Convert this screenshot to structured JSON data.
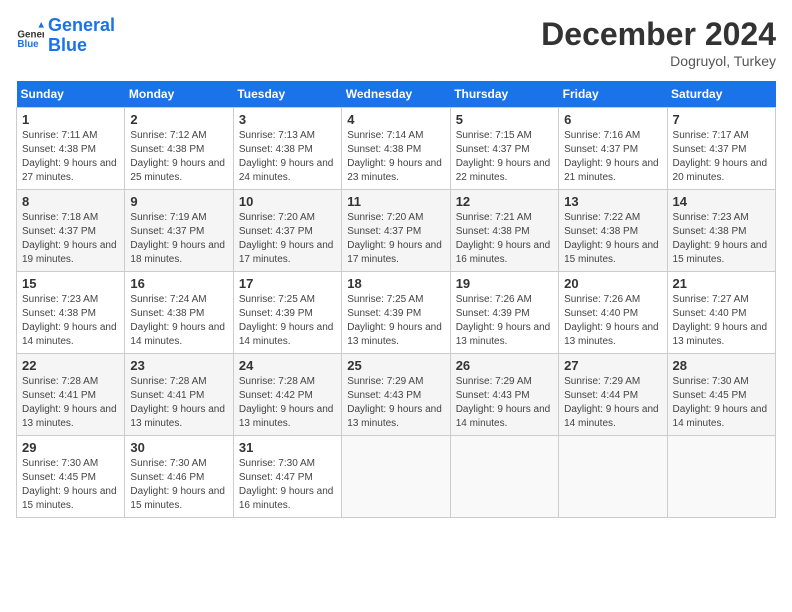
{
  "header": {
    "logo_line1": "General",
    "logo_line2": "Blue",
    "month": "December 2024",
    "location": "Dogruyol, Turkey"
  },
  "weekdays": [
    "Sunday",
    "Monday",
    "Tuesday",
    "Wednesday",
    "Thursday",
    "Friday",
    "Saturday"
  ],
  "weeks": [
    [
      {
        "day": "1",
        "sunrise": "7:11 AM",
        "sunset": "4:38 PM",
        "daylight": "9 hours and 27 minutes."
      },
      {
        "day": "2",
        "sunrise": "7:12 AM",
        "sunset": "4:38 PM",
        "daylight": "9 hours and 25 minutes."
      },
      {
        "day": "3",
        "sunrise": "7:13 AM",
        "sunset": "4:38 PM",
        "daylight": "9 hours and 24 minutes."
      },
      {
        "day": "4",
        "sunrise": "7:14 AM",
        "sunset": "4:38 PM",
        "daylight": "9 hours and 23 minutes."
      },
      {
        "day": "5",
        "sunrise": "7:15 AM",
        "sunset": "4:37 PM",
        "daylight": "9 hours and 22 minutes."
      },
      {
        "day": "6",
        "sunrise": "7:16 AM",
        "sunset": "4:37 PM",
        "daylight": "9 hours and 21 minutes."
      },
      {
        "day": "7",
        "sunrise": "7:17 AM",
        "sunset": "4:37 PM",
        "daylight": "9 hours and 20 minutes."
      }
    ],
    [
      {
        "day": "8",
        "sunrise": "7:18 AM",
        "sunset": "4:37 PM",
        "daylight": "9 hours and 19 minutes."
      },
      {
        "day": "9",
        "sunrise": "7:19 AM",
        "sunset": "4:37 PM",
        "daylight": "9 hours and 18 minutes."
      },
      {
        "day": "10",
        "sunrise": "7:20 AM",
        "sunset": "4:37 PM",
        "daylight": "9 hours and 17 minutes."
      },
      {
        "day": "11",
        "sunrise": "7:20 AM",
        "sunset": "4:37 PM",
        "daylight": "9 hours and 17 minutes."
      },
      {
        "day": "12",
        "sunrise": "7:21 AM",
        "sunset": "4:38 PM",
        "daylight": "9 hours and 16 minutes."
      },
      {
        "day": "13",
        "sunrise": "7:22 AM",
        "sunset": "4:38 PM",
        "daylight": "9 hours and 15 minutes."
      },
      {
        "day": "14",
        "sunrise": "7:23 AM",
        "sunset": "4:38 PM",
        "daylight": "9 hours and 15 minutes."
      }
    ],
    [
      {
        "day": "15",
        "sunrise": "7:23 AM",
        "sunset": "4:38 PM",
        "daylight": "9 hours and 14 minutes."
      },
      {
        "day": "16",
        "sunrise": "7:24 AM",
        "sunset": "4:38 PM",
        "daylight": "9 hours and 14 minutes."
      },
      {
        "day": "17",
        "sunrise": "7:25 AM",
        "sunset": "4:39 PM",
        "daylight": "9 hours and 14 minutes."
      },
      {
        "day": "18",
        "sunrise": "7:25 AM",
        "sunset": "4:39 PM",
        "daylight": "9 hours and 13 minutes."
      },
      {
        "day": "19",
        "sunrise": "7:26 AM",
        "sunset": "4:39 PM",
        "daylight": "9 hours and 13 minutes."
      },
      {
        "day": "20",
        "sunrise": "7:26 AM",
        "sunset": "4:40 PM",
        "daylight": "9 hours and 13 minutes."
      },
      {
        "day": "21",
        "sunrise": "7:27 AM",
        "sunset": "4:40 PM",
        "daylight": "9 hours and 13 minutes."
      }
    ],
    [
      {
        "day": "22",
        "sunrise": "7:28 AM",
        "sunset": "4:41 PM",
        "daylight": "9 hours and 13 minutes."
      },
      {
        "day": "23",
        "sunrise": "7:28 AM",
        "sunset": "4:41 PM",
        "daylight": "9 hours and 13 minutes."
      },
      {
        "day": "24",
        "sunrise": "7:28 AM",
        "sunset": "4:42 PM",
        "daylight": "9 hours and 13 minutes."
      },
      {
        "day": "25",
        "sunrise": "7:29 AM",
        "sunset": "4:43 PM",
        "daylight": "9 hours and 13 minutes."
      },
      {
        "day": "26",
        "sunrise": "7:29 AM",
        "sunset": "4:43 PM",
        "daylight": "9 hours and 14 minutes."
      },
      {
        "day": "27",
        "sunrise": "7:29 AM",
        "sunset": "4:44 PM",
        "daylight": "9 hours and 14 minutes."
      },
      {
        "day": "28",
        "sunrise": "7:30 AM",
        "sunset": "4:45 PM",
        "daylight": "9 hours and 14 minutes."
      }
    ],
    [
      {
        "day": "29",
        "sunrise": "7:30 AM",
        "sunset": "4:45 PM",
        "daylight": "9 hours and 15 minutes."
      },
      {
        "day": "30",
        "sunrise": "7:30 AM",
        "sunset": "4:46 PM",
        "daylight": "9 hours and 15 minutes."
      },
      {
        "day": "31",
        "sunrise": "7:30 AM",
        "sunset": "4:47 PM",
        "daylight": "9 hours and 16 minutes."
      },
      null,
      null,
      null,
      null
    ]
  ]
}
